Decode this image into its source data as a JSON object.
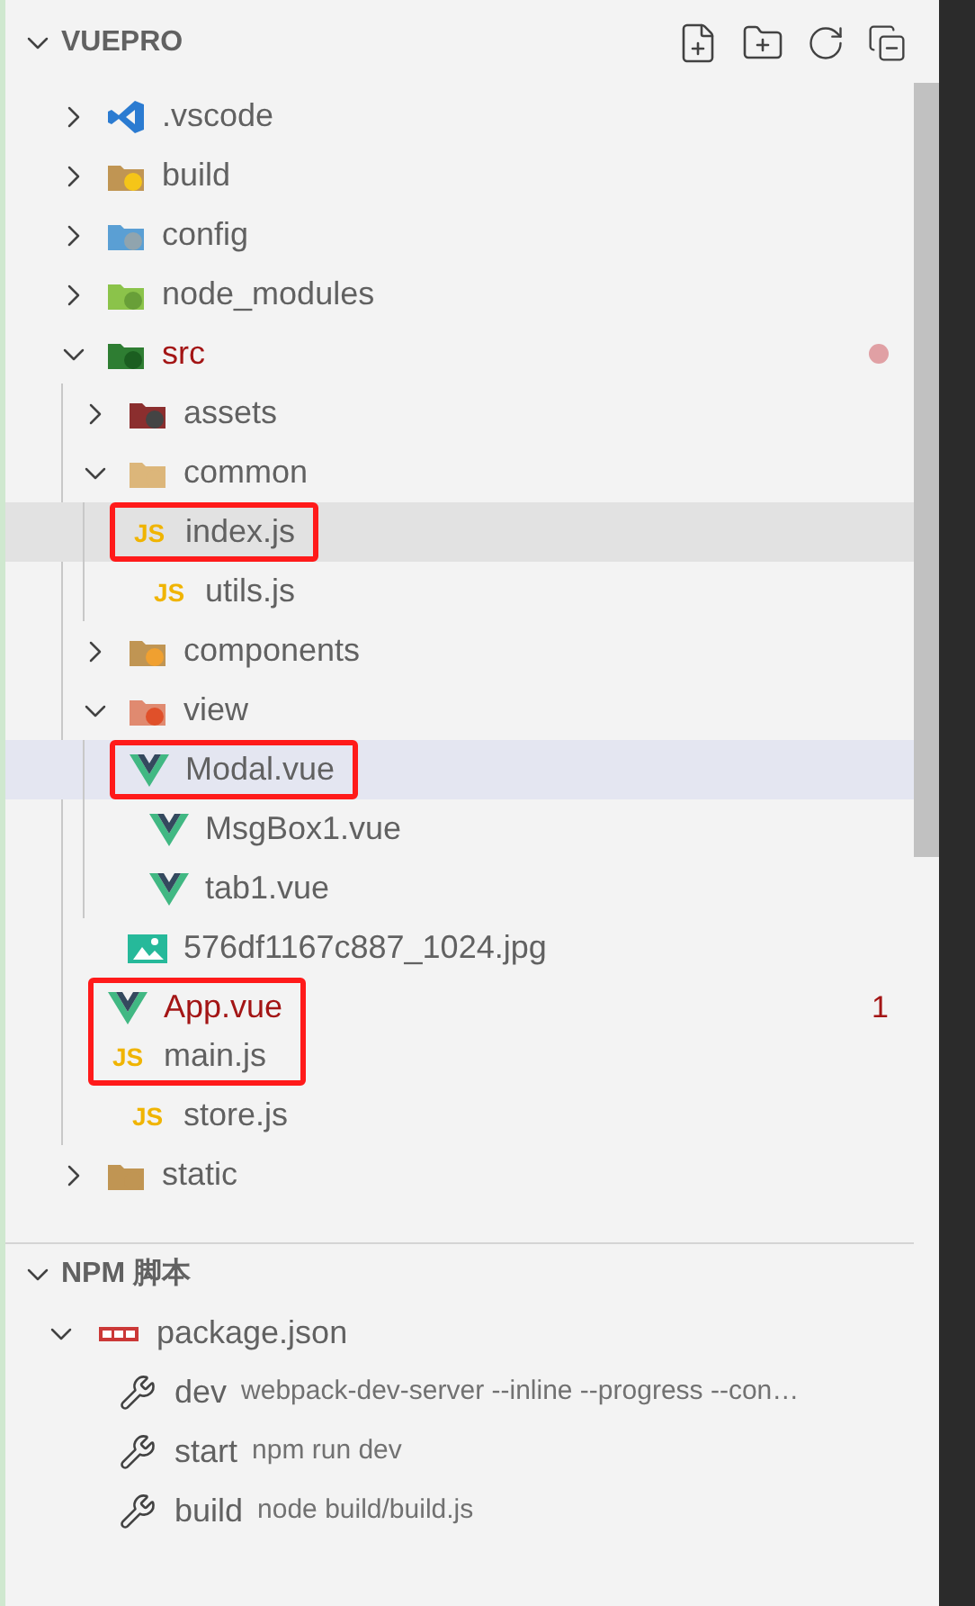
{
  "explorer": {
    "title": "VUEPRO",
    "expanded": true,
    "tree": [
      {
        "name": ".vscode",
        "kind": "folder",
        "expanded": false,
        "selected": false,
        "hovered": false,
        "marked": false,
        "error": false
      },
      {
        "name": "build",
        "kind": "folder",
        "expanded": false,
        "selected": false,
        "hovered": false,
        "marked": false,
        "error": false
      },
      {
        "name": "config",
        "kind": "folder",
        "expanded": false,
        "selected": false,
        "hovered": false,
        "marked": false,
        "error": false
      },
      {
        "name": "node_modules",
        "kind": "folder",
        "expanded": false,
        "selected": false,
        "hovered": false,
        "marked": false,
        "error": false
      },
      {
        "name": "src",
        "kind": "folder",
        "expanded": true,
        "selected": false,
        "hovered": false,
        "marked": false,
        "error": true,
        "children": [
          {
            "name": "assets",
            "kind": "folder",
            "expanded": false,
            "selected": false,
            "hovered": false,
            "marked": false,
            "error": false
          },
          {
            "name": "common",
            "kind": "folder",
            "expanded": true,
            "selected": false,
            "hovered": false,
            "marked": false,
            "error": false,
            "children": [
              {
                "name": "index.js",
                "kind": "js",
                "icon_label": "JS",
                "selected": false,
                "hovered": true,
                "marked": true,
                "error": false
              },
              {
                "name": "utils.js",
                "kind": "js",
                "icon_label": "JS",
                "selected": false,
                "hovered": false,
                "marked": false,
                "error": false
              }
            ]
          },
          {
            "name": "components",
            "kind": "folder",
            "expanded": false,
            "selected": false,
            "hovered": false,
            "marked": false,
            "error": false
          },
          {
            "name": "view",
            "kind": "folder",
            "expanded": true,
            "selected": false,
            "hovered": false,
            "marked": false,
            "error": false,
            "children": [
              {
                "name": "Modal.vue",
                "kind": "vue",
                "selected": true,
                "hovered": false,
                "marked": true,
                "error": false
              },
              {
                "name": "MsgBox1.vue",
                "kind": "vue",
                "selected": false,
                "hovered": false,
                "marked": false,
                "error": false
              },
              {
                "name": "tab1.vue",
                "kind": "vue",
                "selected": false,
                "hovered": false,
                "marked": false,
                "error": false
              }
            ]
          },
          {
            "name": "576df1167c887_1024.jpg",
            "kind": "image",
            "selected": false,
            "hovered": false,
            "marked": false,
            "error": false
          },
          {
            "name": "App.vue",
            "kind": "vue",
            "selected": false,
            "hovered": false,
            "marked": true,
            "error": true,
            "badge": "1"
          },
          {
            "name": "main.js",
            "kind": "js",
            "icon_label": "JS",
            "selected": false,
            "hovered": false,
            "marked": true,
            "error": false
          },
          {
            "name": "store.js",
            "kind": "js",
            "icon_label": "JS",
            "selected": false,
            "hovered": false,
            "marked": false,
            "error": false
          }
        ]
      },
      {
        "name": "static",
        "kind": "folder",
        "expanded": false,
        "selected": false,
        "hovered": false,
        "marked": false,
        "error": false
      }
    ]
  },
  "npm": {
    "title": "NPM 脚本",
    "expanded": true,
    "packages": [
      {
        "name": "package.json",
        "expanded": true,
        "scripts": [
          {
            "name": "dev",
            "command": "webpack-dev-server --inline --progress --con…"
          },
          {
            "name": "start",
            "command": "npm run dev"
          },
          {
            "name": "build",
            "command": "node build/build.js"
          }
        ]
      }
    ]
  }
}
